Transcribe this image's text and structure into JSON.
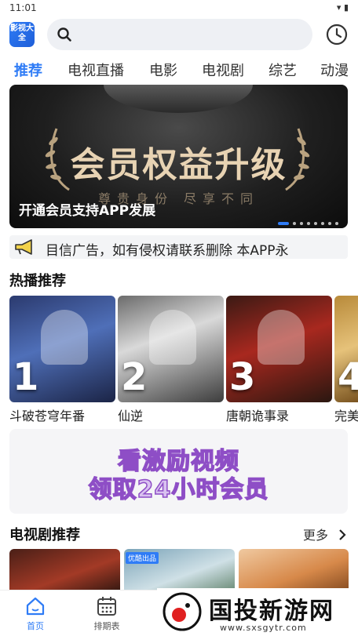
{
  "status_bar": {
    "time": "11:01",
    "icons": "▾ ▮"
  },
  "app": {
    "logo_text": "影视大全"
  },
  "search": {
    "placeholder": ""
  },
  "tabs": [
    {
      "label": "推荐",
      "active": true
    },
    {
      "label": "电视直播"
    },
    {
      "label": "电影"
    },
    {
      "label": "电视剧"
    },
    {
      "label": "综艺"
    },
    {
      "label": "动漫"
    }
  ],
  "banner": {
    "headline": "会员权益升级",
    "subline": "尊贵身份  尽享不同",
    "caption": "开通会员支持APP发展",
    "dot_count": 8,
    "active_dot": 0
  },
  "notice": {
    "text": "目信广告，如有侵权请联系删除      本APP永"
  },
  "hot_section": {
    "title": "热播推荐",
    "items": [
      {
        "rank": "1",
        "name": "斗破苍穹年番"
      },
      {
        "rank": "2",
        "name": "仙逆"
      },
      {
        "rank": "3",
        "name": "唐朝诡事录"
      },
      {
        "rank": "4",
        "name": "完美"
      }
    ]
  },
  "promo": {
    "line1": "看激励视频",
    "line2": "领取24小时会员"
  },
  "drama_section": {
    "title": "电视剧推荐",
    "more_label": "更多",
    "tag": "优酷出品"
  },
  "bottom_nav": [
    {
      "label": "首页",
      "icon": "home-icon",
      "active": true
    },
    {
      "label": "排期表",
      "icon": "calendar-icon"
    }
  ],
  "watermark": {
    "title": "国投新游网",
    "url": "www.sxsgytr.com"
  },
  "colors": {
    "accent": "#2f7cf6"
  }
}
